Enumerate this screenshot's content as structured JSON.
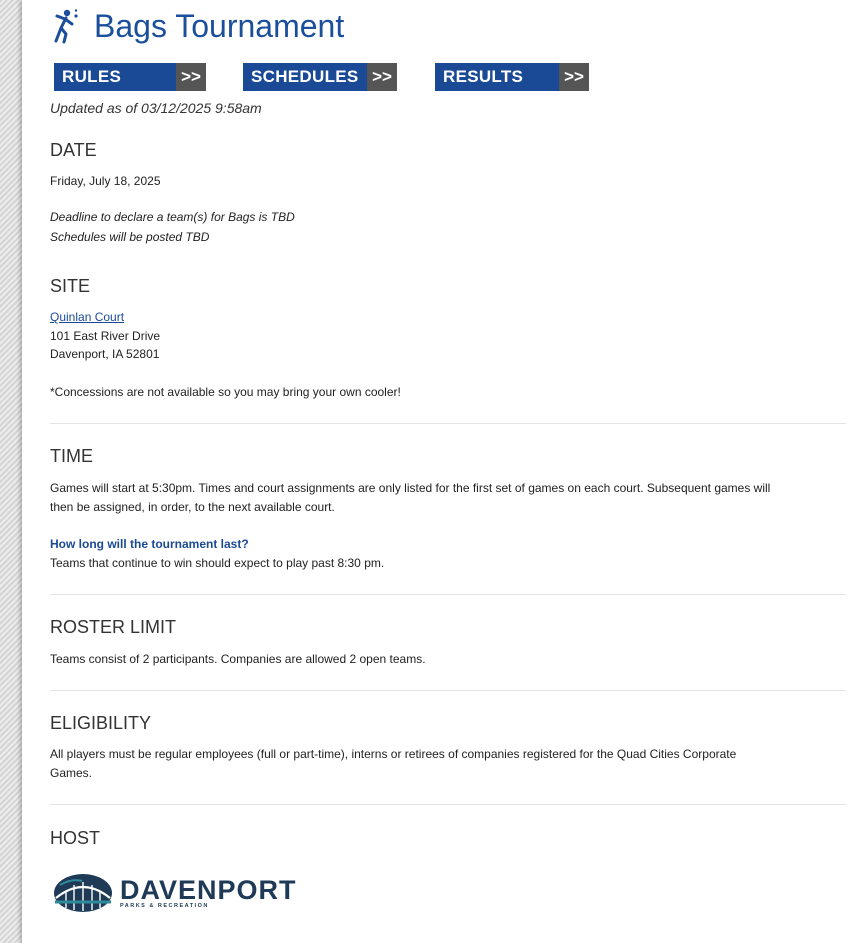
{
  "page": {
    "title": "Bags Tournament",
    "updated": "Updated as of 03/12/2025 9:58am"
  },
  "nav": [
    {
      "label": "RULES",
      "arrow": ">>"
    },
    {
      "label": "SCHEDULES",
      "arrow": ">>"
    },
    {
      "label": "RESULTS",
      "arrow": ">>"
    }
  ],
  "date": {
    "heading": "DATE",
    "value": "Friday, July 18, 2025",
    "note1": "Deadline to declare a team(s) for Bags is TBD",
    "note2": "Schedules will be posted TBD"
  },
  "site": {
    "heading": "SITE",
    "venue_link": "Quinlan Court",
    "address1": "101 East River Drive",
    "address2": "Davenport, IA 52801",
    "note": "*Concessions are not available so you may bring your own cooler!"
  },
  "time": {
    "heading": "TIME",
    "body1": "Games will start at 5:30pm. Times and court assignments are only listed for the first set of games on each court. Subsequent games will",
    "body2": "then be assigned, in order, to the next available court.",
    "question": "How long will the tournament last?",
    "answer": "Teams that continue to win should expect to play past 8:30 pm."
  },
  "roster": {
    "heading": "ROSTER LIMIT",
    "body": "Teams consist of 2 participants. Companies are allowed 2 open teams."
  },
  "eligibility": {
    "heading": "ELIGIBILITY",
    "body1": "All players must be regular employees (full or part-time), interns or retirees of companies registered for the Quad Cities Corporate",
    "body2": "Games."
  },
  "host": {
    "heading": "HOST",
    "logo_name": "DAVENPORT",
    "logo_sub": "PARKS & RECREATION"
  },
  "colors": {
    "brand_blue": "#1a4a95",
    "arrow_gray": "#555555",
    "logo_teal": "#2f8a9a"
  },
  "icons": {
    "title_icon": "runner-icon",
    "logo_icon": "bridge-globe-icon"
  }
}
